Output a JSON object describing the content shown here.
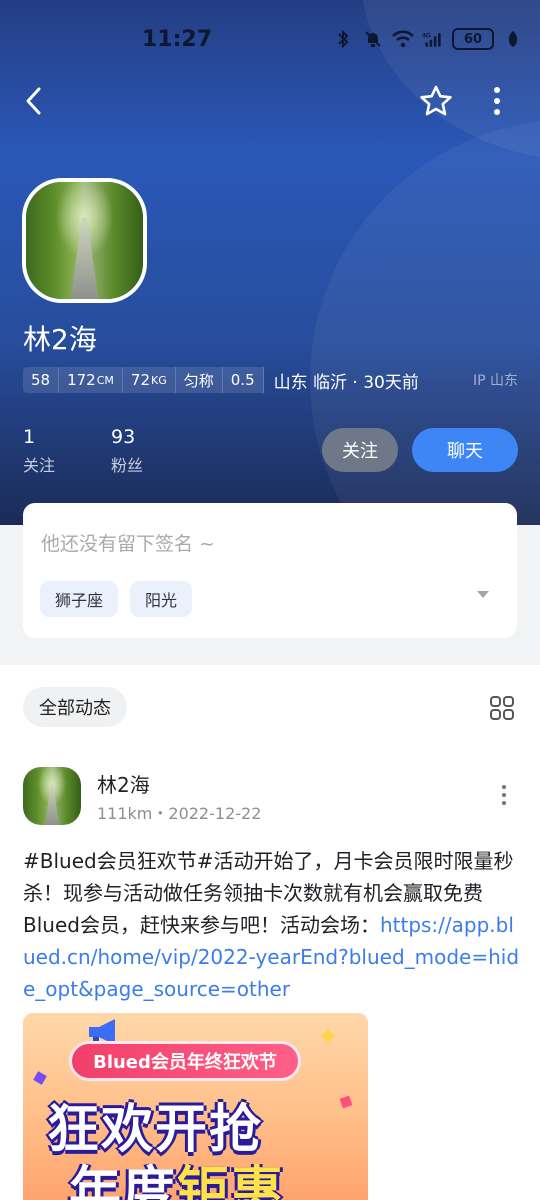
{
  "status_bar": {
    "time": "11:27",
    "icons": [
      "bluetooth-icon",
      "bell-muted-icon",
      "wifi-icon",
      "signal-4g-icon"
    ],
    "battery": "60"
  },
  "nav": {
    "back_icon": "chevron-left-icon",
    "favorite_icon": "star-outline-icon",
    "more_icon": "vertical-dots-icon"
  },
  "profile": {
    "name": "林2海",
    "stats": [
      {
        "value": "58",
        "unit": ""
      },
      {
        "value": "172",
        "unit": "CM"
      },
      {
        "value": "72",
        "unit": "KG"
      },
      {
        "value": "匀称",
        "unit": ""
      },
      {
        "value": "0.5",
        "unit": ""
      }
    ],
    "location": "山东 临沂 · 30天前",
    "ip": "IP 山东",
    "following_count": "1",
    "following_label": "关注",
    "followers_count": "93",
    "followers_label": "粉丝",
    "follow_button": "关注",
    "chat_button": "聊天"
  },
  "signature": {
    "text": "他还没有留下签名 ~",
    "tags": [
      "狮子座",
      "阳光"
    ]
  },
  "feed": {
    "filter_label": "全部动态",
    "post": {
      "author": "林2海",
      "meta": "111km・2022-12-22",
      "text": "#Blued会员狂欢节#活动开始了，月卡会员限时限量秒杀！现参与活动做任务领抽卡次数就有机会赢取免费Blued会员，赶快来参与吧！活动会场：",
      "link": "https://app.blued.cn/home/vip/2022-yearEnd?blued_mode=hide_opt&page_source=other",
      "image": {
        "banner": "Blued会员年终狂欢节",
        "headline": "狂欢开抢",
        "subline_a": "年度",
        "subline_b": "钜惠"
      }
    }
  },
  "colors": {
    "hero_top": "#243e84",
    "hero_bottom": "#1b2b57",
    "chat_button": "#3e86f5",
    "follow_button": "#6e7888",
    "link": "#3b7de9"
  }
}
